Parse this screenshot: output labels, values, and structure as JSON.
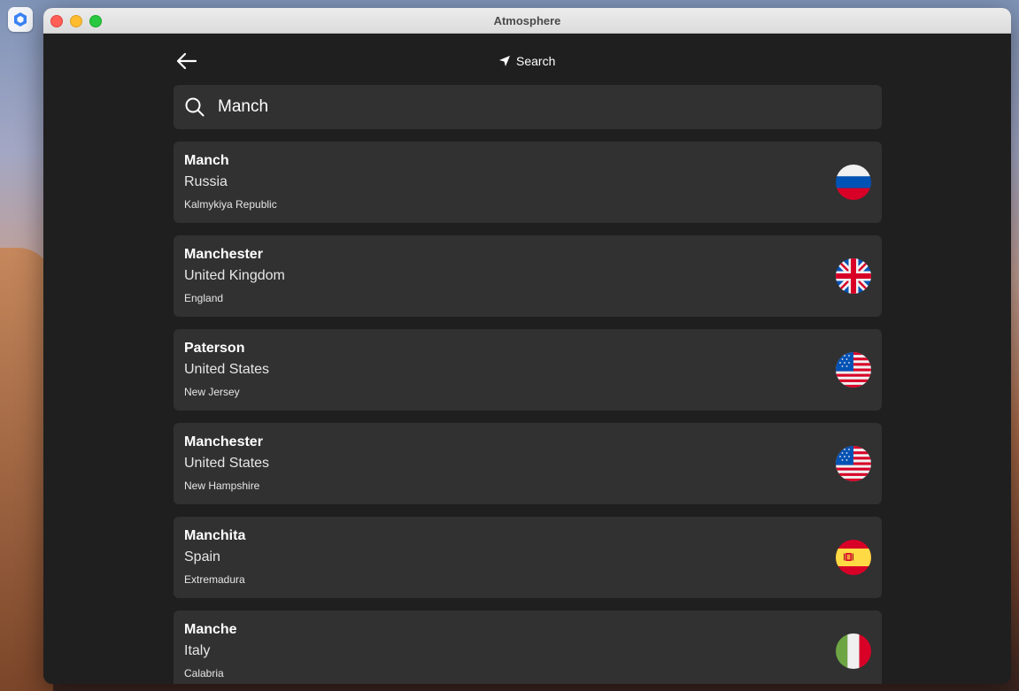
{
  "window": {
    "title": "Atmosphere"
  },
  "header": {
    "search_label": "Search"
  },
  "search": {
    "value": "Manch"
  },
  "results": [
    {
      "city": "Manch",
      "country": "Russia",
      "region": "Kalmykiya Republic",
      "flag": "russia-flag-icon"
    },
    {
      "city": "Manchester",
      "country": "United Kingdom",
      "region": "England",
      "flag": "uk-flag-icon"
    },
    {
      "city": "Paterson",
      "country": "United States",
      "region": "New Jersey",
      "flag": "usa-flag-icon"
    },
    {
      "city": "Manchester",
      "country": "United States",
      "region": "New Hampshire",
      "flag": "usa-flag-icon"
    },
    {
      "city": "Manchita",
      "country": "Spain",
      "region": "Extremadura",
      "flag": "spain-flag-icon"
    },
    {
      "city": "Manche",
      "country": "Italy",
      "region": "Calabria",
      "flag": "italy-flag-icon"
    }
  ],
  "colors": {
    "background": "#1f1f1f",
    "card": "#313131",
    "text": "#ffffff"
  }
}
